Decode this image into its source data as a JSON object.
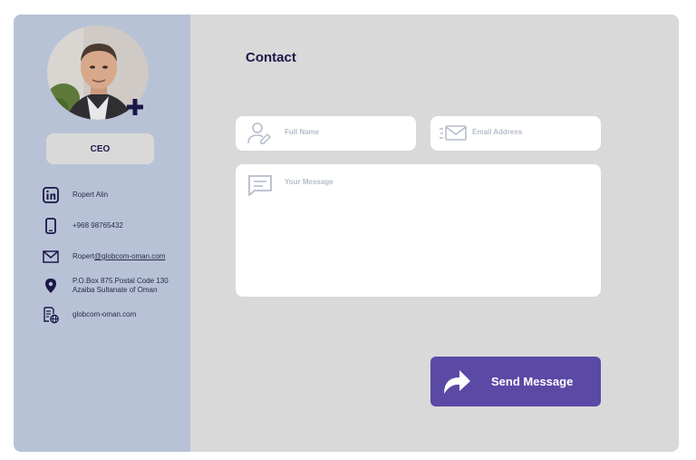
{
  "profile": {
    "role": "CEO",
    "name": "Ropert Alin",
    "phone": "+968 98765432",
    "email_prefix": "Ropert",
    "email_domain": "@globcom-oman.com",
    "address_line1": "P.O.Box 875.Postal Code 130",
    "address_line2": "Azaiba Sultanate of Oman",
    "website": "globcom-oman.com"
  },
  "form": {
    "title": "Contact",
    "full_name_placeholder": "Full Name",
    "email_placeholder": "Email Address",
    "message_placeholder": "Your Message",
    "send_label": "Send Message"
  },
  "icons": {
    "avatar_add": "plus-icon",
    "name": "linkedin-icon",
    "phone": "phone-icon",
    "email": "mail-icon",
    "address": "location-pin-icon",
    "website": "web-document-icon",
    "full_name": "user-edit-icon",
    "email_field": "fast-mail-icon",
    "message": "message-icon",
    "send": "share-arrow-icon"
  },
  "colors": {
    "sidebar": "#b8c2d6",
    "panel": "#d9d9d9",
    "accent": "#5b49a6",
    "text_dark": "#1b1748",
    "placeholder": "#b6bccb"
  }
}
